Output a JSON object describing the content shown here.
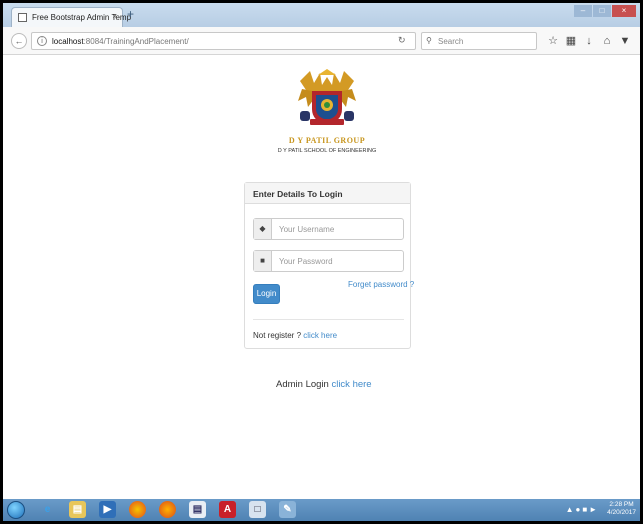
{
  "browser": {
    "tab_title": "Free Bootstrap Admin Temp",
    "tab_close": "×",
    "new_tab": "+",
    "url_host": "localhost",
    "url_path": ":8084/TrainingAndPlacement/",
    "search_placeholder": "Search",
    "window_buttons": [
      "–",
      "□",
      "×"
    ]
  },
  "header": {
    "brand": "D Y PATIL GROUP",
    "college": "D Y PATIL SCHOOL OF ENGINEERING"
  },
  "login": {
    "heading": "Enter Details To Login",
    "username_placeholder": "Your Username",
    "password_placeholder": "Your Password",
    "login_label": "Login",
    "forgot_label": "Forget password ?",
    "register_prefix": "Not register ?",
    "register_link": "click here"
  },
  "admin": {
    "prefix": "Admin Login",
    "link": "click here"
  },
  "taskbar": {
    "time": "2:28 PM",
    "date": "4/20/2017"
  },
  "colors": {
    "primary": "#428bca",
    "brand_gold": "#c8961e",
    "taskbar": "#5a8ec0"
  }
}
